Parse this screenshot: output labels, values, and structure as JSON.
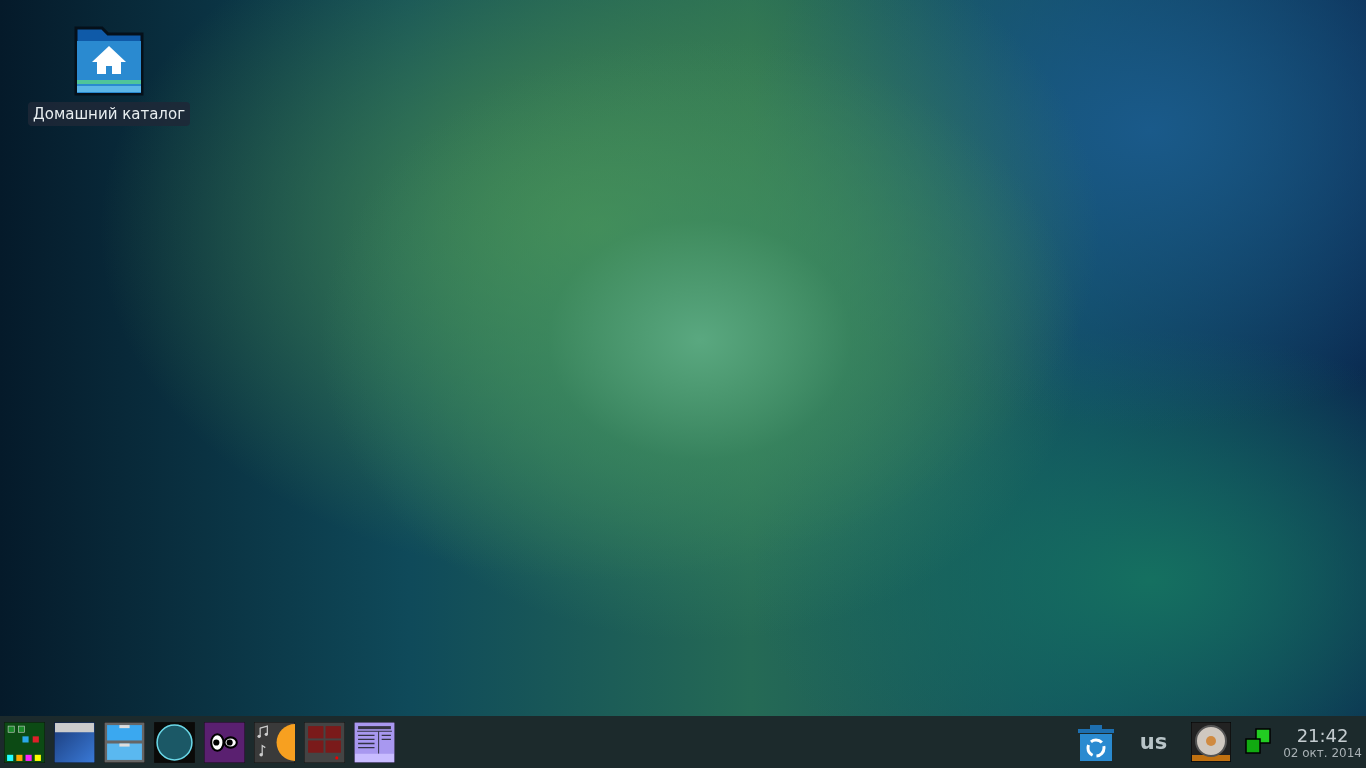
{
  "desktop_icons": [
    {
      "label": "Домашний каталог"
    }
  ],
  "taskbar": {
    "keyboard_layout": "us",
    "clock": {
      "time": "21:42",
      "date": "02 окт. 2014"
    }
  }
}
